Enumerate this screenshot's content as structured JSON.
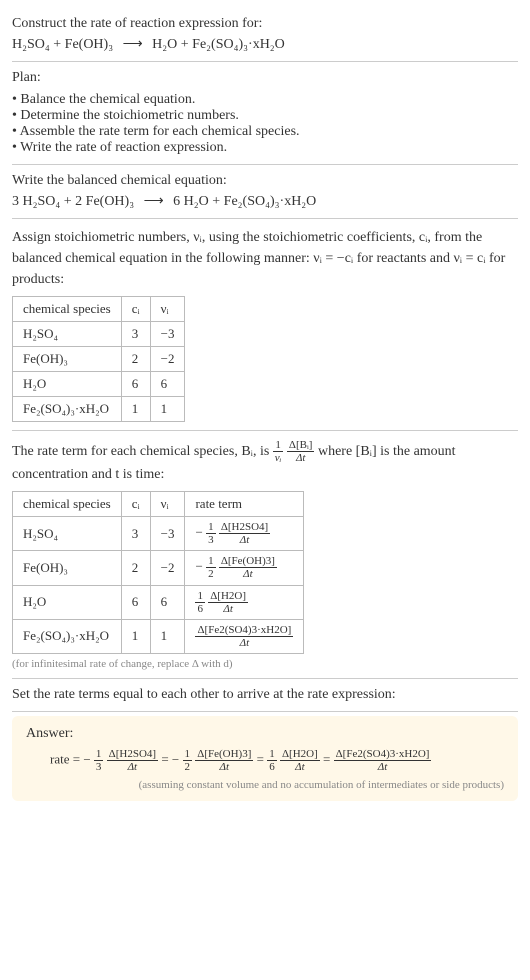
{
  "problem": {
    "prompt": "Construct the rate of reaction expression for:",
    "equation_left": "H₂SO₄ + Fe(OH)₃",
    "arrow": "⟶",
    "equation_right": "H₂O + Fe₂(SO₄)₃·xH₂O"
  },
  "plan": {
    "title": "Plan:",
    "items": [
      "Balance the chemical equation.",
      "Determine the stoichiometric numbers.",
      "Assemble the rate term for each chemical species.",
      "Write the rate of reaction expression."
    ]
  },
  "balanced": {
    "title": "Write the balanced chemical equation:",
    "equation_left": "3 H₂SO₄ + 2 Fe(OH)₃",
    "arrow": "⟶",
    "equation_right": "6 H₂O + Fe₂(SO₄)₃·xH₂O"
  },
  "stoich": {
    "intro_a": "Assign stoichiometric numbers, νᵢ, using the stoichiometric coefficients, cᵢ, from the balanced chemical equation in the following manner: νᵢ = −cᵢ for reactants and νᵢ = cᵢ for products:",
    "headers": [
      "chemical species",
      "cᵢ",
      "νᵢ"
    ],
    "rows": [
      {
        "species": "H₂SO₄",
        "c": "3",
        "nu": "−3"
      },
      {
        "species": "Fe(OH)₃",
        "c": "2",
        "nu": "−2"
      },
      {
        "species": "H₂O",
        "c": "6",
        "nu": "6"
      },
      {
        "species": "Fe₂(SO₄)₃·xH₂O",
        "c": "1",
        "nu": "1"
      }
    ]
  },
  "rate": {
    "intro_a": "The rate term for each chemical species, Bᵢ, is ",
    "intro_b": " where [Bᵢ] is the amount concentration and t is time:",
    "frac1_num": "1",
    "frac1_den": "νᵢ",
    "frac2_num": "Δ[Bᵢ]",
    "frac2_den": "Δt",
    "headers": [
      "chemical species",
      "cᵢ",
      "νᵢ",
      "rate term"
    ],
    "rows": [
      {
        "species": "H₂SO₄",
        "c": "3",
        "nu": "−3",
        "sign": "−",
        "coef_num": "1",
        "coef_den": "3",
        "conc_num": "Δ[H2SO4]",
        "conc_den": "Δt"
      },
      {
        "species": "Fe(OH)₃",
        "c": "2",
        "nu": "−2",
        "sign": "−",
        "coef_num": "1",
        "coef_den": "2",
        "conc_num": "Δ[Fe(OH)3]",
        "conc_den": "Δt"
      },
      {
        "species": "H₂O",
        "c": "6",
        "nu": "6",
        "sign": "",
        "coef_num": "1",
        "coef_den": "6",
        "conc_num": "Δ[H2O]",
        "conc_den": "Δt"
      },
      {
        "species": "Fe₂(SO₄)₃·xH₂O",
        "c": "1",
        "nu": "1",
        "sign": "",
        "coef_num": "",
        "coef_den": "",
        "conc_num": "Δ[Fe2(SO4)3·xH2O]",
        "conc_den": "Δt"
      }
    ],
    "footnote": "(for infinitesimal rate of change, replace Δ with d)"
  },
  "final": {
    "title": "Set the rate terms equal to each other to arrive at the rate expression:"
  },
  "answer": {
    "title": "Answer:",
    "rate_label": "rate =",
    "terms": [
      {
        "sign": "−",
        "coef_num": "1",
        "coef_den": "3",
        "conc_num": "Δ[H2SO4]",
        "conc_den": "Δt"
      },
      {
        "sign": "−",
        "coef_num": "1",
        "coef_den": "2",
        "conc_num": "Δ[Fe(OH)3]",
        "conc_den": "Δt"
      },
      {
        "sign": "",
        "coef_num": "1",
        "coef_den": "6",
        "conc_num": "Δ[H2O]",
        "conc_den": "Δt"
      },
      {
        "sign": "",
        "coef_num": "",
        "coef_den": "",
        "conc_num": "Δ[Fe2(SO4)3·xH2O]",
        "conc_den": "Δt"
      }
    ],
    "eq": " = ",
    "note": "(assuming constant volume and no accumulation of intermediates or side products)"
  }
}
